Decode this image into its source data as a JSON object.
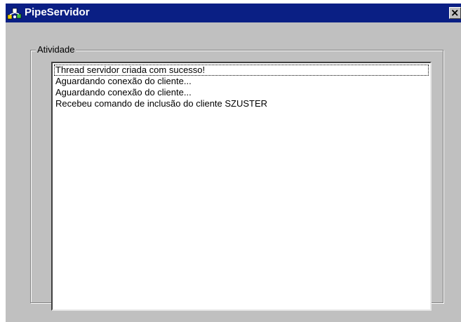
{
  "window": {
    "title": "PipeServidor",
    "close_label": "×"
  },
  "groupbox": {
    "label": "Atividade"
  },
  "listbox": {
    "items": [
      "Thread servidor criada com sucesso!",
      "Aguardando conexão do cliente...",
      "Aguardando conexão do cliente...",
      "Recebeu comando de inclusão do cliente SZUSTER"
    ],
    "focused_index": 0
  },
  "colors": {
    "titlebar": "#0a1f84",
    "client": "#c0c0c0",
    "listbox_bg": "#ffffff"
  }
}
